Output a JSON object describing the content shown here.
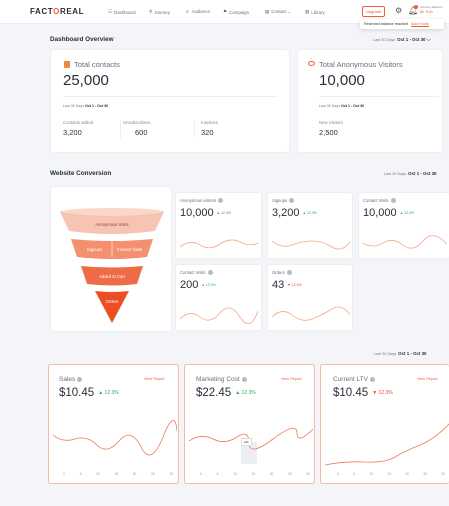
{
  "brand": {
    "logo_pre": "FACT",
    "logo_o": "O",
    "logo_post": "REAL"
  },
  "nav": [
    {
      "icon": "dashboard-icon",
      "glyph": "☷",
      "label": "Dashboard"
    },
    {
      "icon": "journey-icon",
      "glyph": "⚲",
      "label": "Journey"
    },
    {
      "icon": "audience-icon",
      "glyph": "☺",
      "label": "Audience"
    },
    {
      "icon": "campaign-icon",
      "glyph": "⚑",
      "label": "Campaign"
    },
    {
      "icon": "contact-icon",
      "glyph": "▤",
      "label": "Contact ⌄"
    },
    {
      "icon": "library-icon",
      "glyph": "▥",
      "label": "Library"
    }
  ],
  "header": {
    "upgrade": "Upgrade",
    "balance_label": "Account Balance",
    "balance_value": "$0 Trch",
    "tooltip_text": "Reserved balance reached",
    "tooltip_link": "Add Funds"
  },
  "overview": {
    "title": "Dashboard Overview",
    "range_label": "Last 30 Days",
    "range_value": "Oct 1 - Oct 30",
    "contacts": {
      "title": "Total contacts",
      "value": "25,000",
      "range_label": "Last 30 Days",
      "range_value": "Oct 1 - Oct 30",
      "subs": [
        {
          "label": "Contacts added",
          "value": "3,200"
        },
        {
          "label": "Unsubscribers",
          "value": "600"
        },
        {
          "label": "Inactives",
          "value": "320"
        }
      ]
    },
    "visitors": {
      "title": "Total Anonymous Visitors",
      "value": "10,000",
      "range_label": "Last 30 Days",
      "range_value": "Oct 1 - Oct 30",
      "subs": [
        {
          "label": "New Visitors",
          "value": "2,500"
        }
      ]
    }
  },
  "conversion": {
    "title": "Website Conversion",
    "range_label": "Last 30 Days",
    "range_value": "Oct 1 - Oct 30",
    "funnel": [
      "Anonymous Visits",
      "Signups",
      "Contact Visits",
      "Added to Cart",
      "Orders"
    ],
    "metrics": [
      {
        "title": "Anonymous visitors",
        "value": "10,000",
        "trend": "▲ 12.3%",
        "dir": "up"
      },
      {
        "title": "Signups",
        "value": "3,200",
        "trend": "▲ 12.3%",
        "dir": "up"
      },
      {
        "title": "Contact Visits",
        "value": "10,000",
        "trend": "▲ 12.3%",
        "dir": "up"
      },
      {
        "title": "Contact Visits",
        "value": "200",
        "trend": "▲ 12.3%",
        "dir": "up"
      },
      {
        "title": "Orders",
        "value": "43",
        "trend": "▼ 12.3%",
        "dir": "down"
      }
    ]
  },
  "reports": {
    "range_label": "Last 30 Days",
    "range_value": "Oct 1 - Oct 30",
    "link": "View Report",
    "cards": [
      {
        "title": "Sales",
        "value": "$10.45",
        "trend": "▲ 12.3%",
        "dir": "up"
      },
      {
        "title": "Marketing Cost",
        "value": "$22.45",
        "trend": "▲ 12.3%",
        "dir": "up"
      },
      {
        "title": "Current LTV",
        "value": "$10.45",
        "trend": "▼ 12.3%",
        "dir": "down"
      }
    ],
    "tooltip": "10k",
    "xticks": [
      "0",
      "5",
      "10",
      "15",
      "20",
      "25",
      "30"
    ]
  },
  "colors": {
    "accent": "#ef5f3a",
    "up": "#2eaa5a",
    "down": "#e8423f",
    "line": "#ef8a6a"
  }
}
